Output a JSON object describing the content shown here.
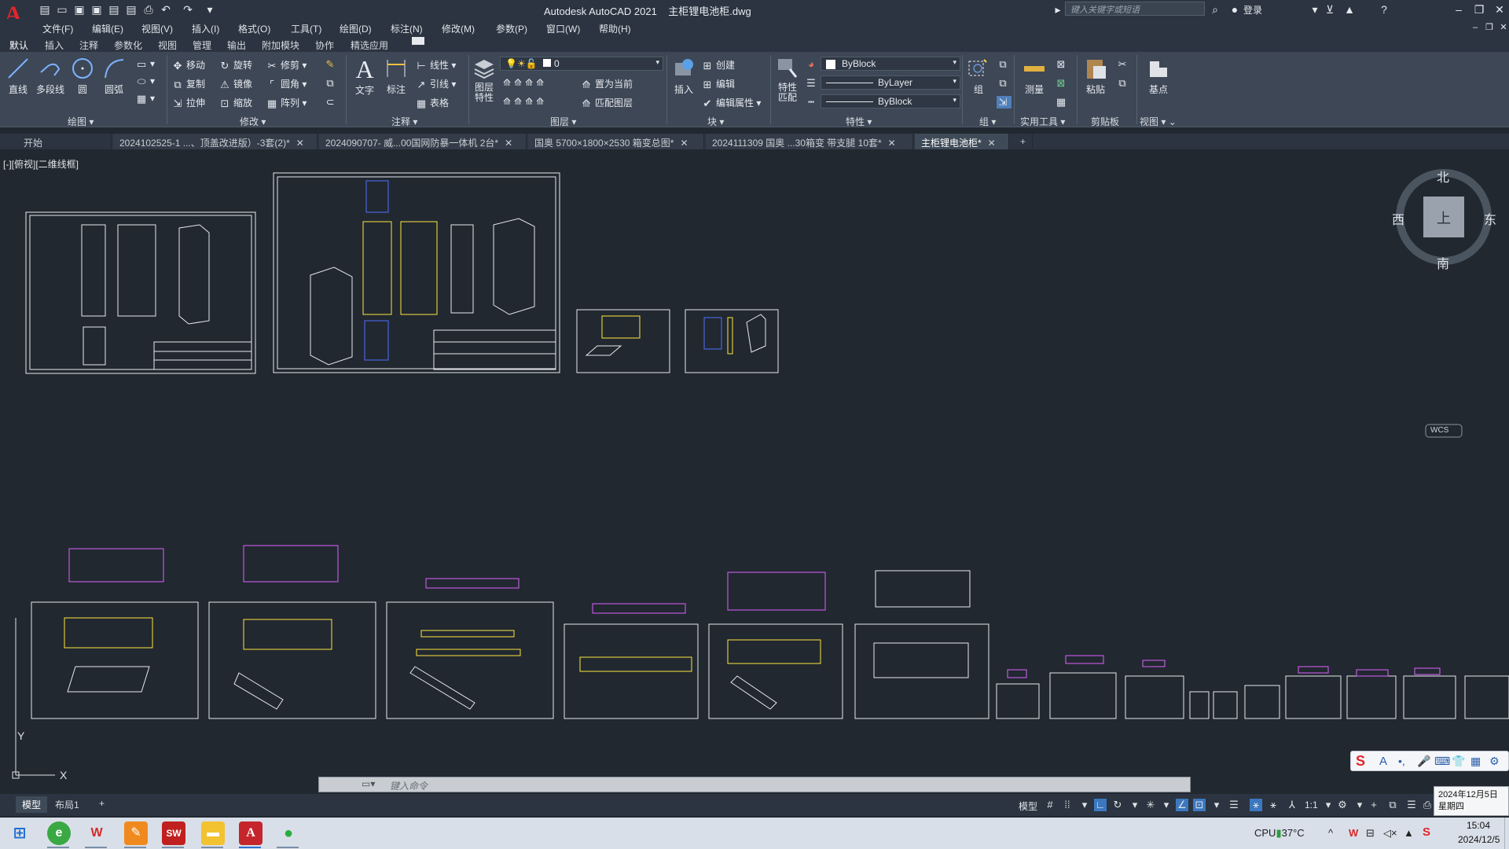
{
  "app": {
    "title_app": "Autodesk AutoCAD 2021",
    "title_file": "主柜锂电池柜.dwg",
    "search_placeholder": "键入关键字或短语",
    "login_label": "登录",
    "accent_color": "#e0262c"
  },
  "menu": [
    "文件(F)",
    "编辑(E)",
    "视图(V)",
    "插入(I)",
    "格式(O)",
    "工具(T)",
    "绘图(D)",
    "标注(N)",
    "修改(M)",
    "参数(P)",
    "窗口(W)",
    "帮助(H)"
  ],
  "ribbon_tabs": [
    "默认",
    "插入",
    "注释",
    "参数化",
    "视图",
    "管理",
    "输出",
    "附加模块",
    "协作",
    "精选应用"
  ],
  "ribbon": {
    "draw": {
      "panel": "绘图",
      "line": "直线",
      "polyline": "多段线",
      "circle": "圆",
      "arc": "圆弧"
    },
    "modify": {
      "panel": "修改",
      "move": "移动",
      "rotate": "旋转",
      "trim": "修剪",
      "copy": "复制",
      "mirror": "镜像",
      "fillet": "圆角",
      "stretch": "拉伸",
      "scale": "缩放",
      "array": "阵列"
    },
    "annotation": {
      "panel": "注释",
      "text": "文字",
      "dimension": "标注",
      "linetype": "线性",
      "leader": "引线",
      "table": "表格"
    },
    "layers": {
      "panel": "图层",
      "layer_props": "图层\n特性",
      "layer_current_value": "0",
      "make_current": "置为当前",
      "match_layer": "匹配图层"
    },
    "block": {
      "panel": "块",
      "insert": "插入",
      "create": "创建",
      "edit": "编辑",
      "edit_attr": "编辑属性"
    },
    "properties": {
      "panel": "特性",
      "match": "特性\n匹配",
      "color_value": "ByBlock",
      "linetype_value": "ByLayer",
      "lineweight_value": "ByBlock"
    },
    "groups": {
      "panel": "组",
      "group": "组"
    },
    "utilities": {
      "panel": "实用工具",
      "measure": "测量"
    },
    "clipboard": {
      "panel": "剪贴板",
      "paste": "粘贴"
    },
    "view": {
      "panel": "视图",
      "base": "基点"
    }
  },
  "doc_tabs": [
    {
      "label": "开始",
      "closable": false
    },
    {
      "label": "2024102525-1 ...、顶盖改进版）-3套(2)*",
      "closable": true
    },
    {
      "label": "2024090707- 威...00国网防暴一体机 2台*",
      "closable": true
    },
    {
      "label": "国奥 5700×1800×2530 箱变总图*",
      "closable": true
    },
    {
      "label": "2024111309 国奥 ...30箱变 带支腿 10套*",
      "closable": true
    },
    {
      "label": "主柜锂电池柜*",
      "closable": true,
      "active": true
    }
  ],
  "viewport_label": "[-][俯视][二维线框]",
  "viewcube": {
    "north": "北",
    "south": "南",
    "east": "东",
    "west": "西",
    "top": "上",
    "wcs": "WCS"
  },
  "ucs": {
    "y": "Y",
    "x": "X"
  },
  "command_line": {
    "placeholder": "键入命令"
  },
  "layout_tabs": [
    "模型",
    "布局1"
  ],
  "status": {
    "model": "模型",
    "scale": "1:1"
  },
  "ime": {
    "label": "A"
  },
  "tray": {
    "cpu": "CPU",
    "temp": "37°C",
    "time": "15:04",
    "date": "2024/12/5"
  },
  "tooltip": {
    "line1": "2024年12月5日",
    "line2": "星期四"
  }
}
